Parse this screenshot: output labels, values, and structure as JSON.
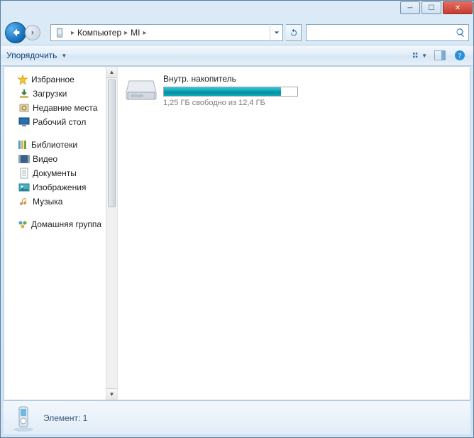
{
  "titlebar": {
    "minimize": "—",
    "maximize": "❐",
    "close": "✕"
  },
  "address": {
    "root": "Компьютер",
    "folder": "MI"
  },
  "toolbar": {
    "organize_label": "Упорядочить"
  },
  "sidebar": {
    "favorites": {
      "label": "Избранное",
      "items": [
        {
          "label": "Загрузки"
        },
        {
          "label": "Недавние места"
        },
        {
          "label": "Рабочий стол"
        }
      ]
    },
    "libraries": {
      "label": "Библиотеки",
      "items": [
        {
          "label": "Видео"
        },
        {
          "label": "Документы"
        },
        {
          "label": "Изображения"
        },
        {
          "label": "Музыка"
        }
      ]
    },
    "homegroup": {
      "label": "Домашняя группа"
    }
  },
  "drive": {
    "name": "Внутр. накопитель",
    "free_text": "1,25 ГБ свободно из 12,4 ГБ",
    "fill_percent": 88
  },
  "status": {
    "text": "Элемент: 1"
  }
}
